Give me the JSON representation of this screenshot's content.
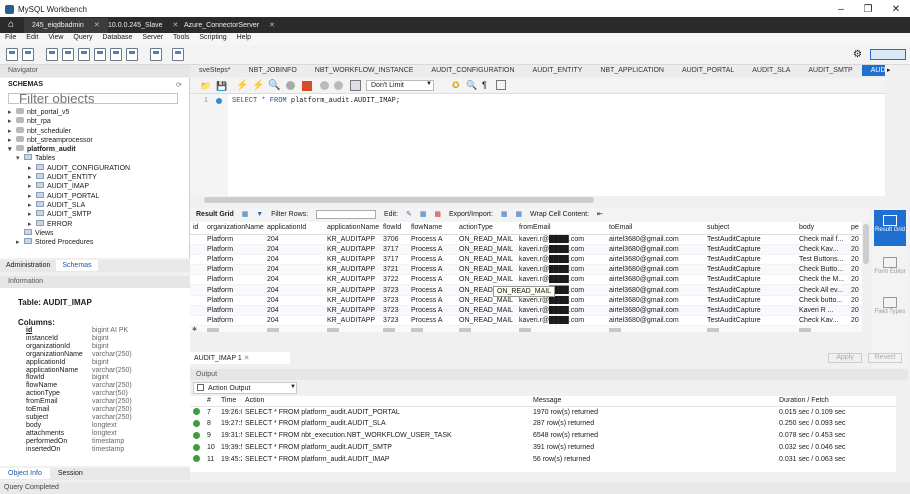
{
  "window": {
    "title": "MySQL Workbench"
  },
  "connection_tabs": [
    {
      "label": "245_eiqdbadmin"
    },
    {
      "label": "10.0.0.245_Slave"
    },
    {
      "label": "Azure_ConnectorServer"
    }
  ],
  "menu": [
    "File",
    "Edit",
    "View",
    "Query",
    "Database",
    "Server",
    "Tools",
    "Scripting",
    "Help"
  ],
  "navigator": {
    "header": "Navigator",
    "schemas_title": "SCHEMAS",
    "filter_placeholder": "Filter objects",
    "schemas": [
      {
        "label": "nbt_portal_v5"
      },
      {
        "label": "nbt_rpa"
      },
      {
        "label": "nbt_scheduler"
      },
      {
        "label": "nbt_streamprocessor"
      },
      {
        "label": "platform_audit"
      }
    ],
    "tables_label": "Tables",
    "tables": [
      "AUDIT_CONFIGURATION",
      "AUDIT_ENTITY",
      "AUDIT_IMAP",
      "AUDIT_PORTAL",
      "AUDIT_SLA",
      "AUDIT_SMTP",
      "ERROR"
    ],
    "views_label": "Views",
    "procedures_label": "Stored Procedures",
    "tabs": {
      "admin": "Administration",
      "schemas": "Schemas"
    }
  },
  "info": {
    "header": "Information",
    "table_title": "Table: AUDIT_IMAP",
    "columns_title": "Columns:",
    "columns": [
      {
        "name": "id",
        "type": "bigint AI PK"
      },
      {
        "name": "instanceId",
        "type": "bigint"
      },
      {
        "name": "organizationId",
        "type": "bigint"
      },
      {
        "name": "organizationName",
        "type": "varchar(250)"
      },
      {
        "name": "applicationId",
        "type": "bigint"
      },
      {
        "name": "applicationName",
        "type": "varchar(250)"
      },
      {
        "name": "flowId",
        "type": "bigint"
      },
      {
        "name": "flowName",
        "type": "varchar(250)"
      },
      {
        "name": "actionType",
        "type": "varchar(50)"
      },
      {
        "name": "fromEmail",
        "type": "varchar(250)"
      },
      {
        "name": "toEmail",
        "type": "varchar(250)"
      },
      {
        "name": "subject",
        "type": "varchar(250)"
      },
      {
        "name": "body",
        "type": "longtext"
      },
      {
        "name": "attachments",
        "type": "longtext"
      },
      {
        "name": "performedOn",
        "type": "timestamp"
      },
      {
        "name": "insertedOn",
        "type": "timestamp"
      }
    ],
    "tabs": {
      "object": "Object Info",
      "session": "Session"
    }
  },
  "query_tabs": [
    "sveSteps*",
    "NBT_JOBINFO",
    "NBT_WORKFLOW_INSTANCE",
    "AUDIT_CONFIGURATION",
    "AUDIT_ENTITY",
    "NBT_APPLICATION",
    "AUDIT_PORTAL",
    "AUDIT_SLA",
    "AUDIT_SMTP",
    "AUDIT_IMAP"
  ],
  "editor": {
    "limit": "Don't Limit",
    "line_number": "1",
    "sql_keyword": "SELECT * FROM",
    "sql_rest": "platform_audit.AUDIT_IMAP;"
  },
  "result_toolbar": {
    "result_grid": "Result Grid",
    "filter_rows": "Filter Rows:",
    "edit": "Edit:",
    "export_import": "Export/Import:",
    "wrap": "Wrap Cell Content:"
  },
  "grid": {
    "columns": [
      "id",
      "organizationName",
      "applicationId",
      "applicationName",
      "flowId",
      "flowName",
      "actionType",
      "fromEmail",
      "toEmail",
      "subject",
      "body",
      "pe"
    ],
    "rows": [
      [
        "",
        "Platform",
        "204",
        "KR_AUDITAPP",
        "3706",
        "Process A",
        "ON_READ_MAIL",
        "kaveri.r@████.com",
        "airtel3680@gmail.com",
        "TestAuditCapture",
        "Check mail f...",
        "20"
      ],
      [
        "",
        "Platform",
        "204",
        "KR_AUDITAPP",
        "3717",
        "Process A",
        "ON_READ_MAIL",
        "kaveri.r@████.com",
        "airtel3680@gmail.com",
        "TestAuditCapture",
        "Check  Kav...",
        "20"
      ],
      [
        "",
        "Platform",
        "204",
        "KR_AUDITAPP",
        "3717",
        "Process A",
        "ON_READ_MAIL",
        "kaveri.r@████.com",
        "airtel3680@gmail.com",
        "TestAuditCapture",
        "Test Buttons...",
        "20"
      ],
      [
        "",
        "Platform",
        "204",
        "KR_AUDITAPP",
        "3721",
        "Process A",
        "ON_READ_MAIL",
        "kaveri.r@████.com",
        "airtel3680@gmail.com",
        "TestAuditCapture",
        "Check Butto...",
        "20"
      ],
      [
        "",
        "Platform",
        "204",
        "KR_AUDITAPP",
        "3722",
        "Process A",
        "ON_READ_MAIL",
        "kaveri.r@████.com",
        "airtel3680@gmail.com",
        "TestAuditCapture",
        "Check the M...",
        "20"
      ],
      [
        "",
        "Platform",
        "204",
        "KR_AUDITAPP",
        "3723",
        "Process A",
        "ON_READ_MAIL",
        "kaveri.r@████.com",
        "airtel3680@gmail.com",
        "TestAuditCapture",
        "Check All ev...",
        "20"
      ],
      [
        "",
        "Platform",
        "204",
        "KR_AUDITAPP",
        "3723",
        "Process A",
        "ON_READ_MAIL",
        "kaveri.r@████.com",
        "airtel3680@gmail.com",
        "TestAuditCapture",
        "Check butto...",
        "20"
      ],
      [
        "",
        "Platform",
        "204",
        "KR_AUDITAPP",
        "3723",
        "Process A",
        "ON_READ_MAIL",
        "kaveri.r@████.com",
        "airtel3680@gmail.com",
        "TestAuditCapture",
        "Kaveri R ...",
        "20"
      ],
      [
        "",
        "Platform",
        "204",
        "KR_AUDITAPP",
        "3723",
        "Process A",
        "ON_READ_MAIL",
        "kaveri.r@████.com",
        "airtel3680@gmail.com",
        "TestAuditCapture",
        "Check  Kav...",
        "20"
      ]
    ],
    "tooltip": "ON_READ_MAIL"
  },
  "right_pane": [
    "Result Grid",
    "Form Editor",
    "Field Types"
  ],
  "result_tab": "AUDIT_IMAP 1",
  "buttons": {
    "apply": "Apply",
    "revert": "Revert"
  },
  "output": {
    "header": "Output",
    "selector": "Action Output",
    "columns": [
      "#",
      "Time",
      "Action",
      "Message",
      "Duration / Fetch"
    ],
    "rows": [
      [
        "7",
        "19:26:08",
        "SELECT * FROM platform_audit.AUDIT_PORTAL",
        "1970 row(s) returned",
        "0.015 sec / 0.109 sec"
      ],
      [
        "8",
        "19:27:51",
        "SELECT * FROM platform_audit.AUDIT_SLA",
        "287 row(s) returned",
        "0.250 sec / 0.093 sec"
      ],
      [
        "9",
        "19:31:53",
        "SELECT * FROM nbt_execution.NBT_WORKFLOW_USER_TASK",
        "6548 row(s) returned",
        "0.078 sec / 0.453 sec"
      ],
      [
        "10",
        "19:39:55",
        "SELECT * FROM platform_audit.AUDIT_SMTP",
        "391 row(s) returned",
        "0.032 sec / 0.046 sec"
      ],
      [
        "11",
        "19:45:23",
        "SELECT * FROM platform_audit.AUDIT_IMAP",
        "56 row(s) returned",
        "0.031 sec / 0.063 sec"
      ]
    ]
  },
  "status": "Query Completed"
}
